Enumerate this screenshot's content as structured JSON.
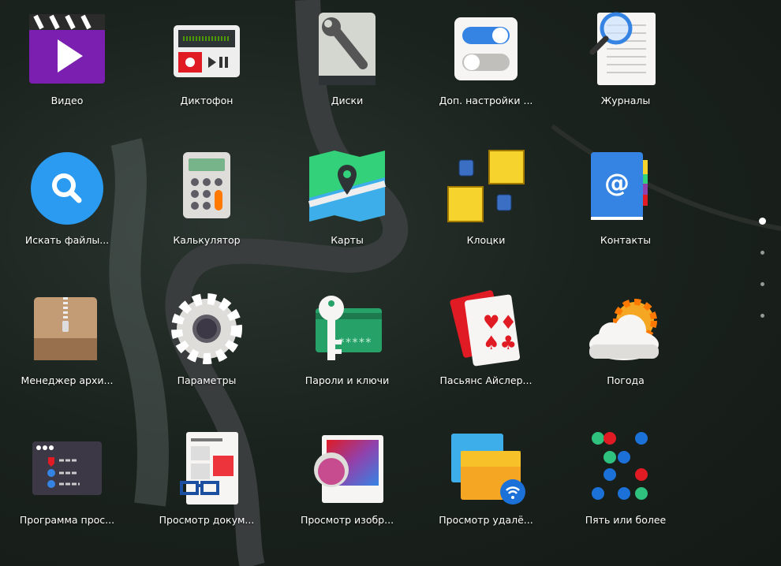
{
  "apps": [
    {
      "label": "Видео",
      "icon": "video-icon"
    },
    {
      "label": "Диктофон",
      "icon": "sound-recorder-icon"
    },
    {
      "label": "Диски",
      "icon": "disks-icon"
    },
    {
      "label": "Доп. настройки ...",
      "icon": "tweaks-icon"
    },
    {
      "label": "Журналы",
      "icon": "logs-icon"
    },
    {
      "label": "Искать файлы...",
      "icon": "search-files-icon"
    },
    {
      "label": "Калькулятор",
      "icon": "calculator-icon"
    },
    {
      "label": "Карты",
      "icon": "maps-icon"
    },
    {
      "label": "Клоцки",
      "icon": "klotski-icon"
    },
    {
      "label": "Контакты",
      "icon": "contacts-icon"
    },
    {
      "label": "Менеджер архи...",
      "icon": "archive-manager-icon"
    },
    {
      "label": "Параметры",
      "icon": "settings-icon"
    },
    {
      "label": "Пароли и ключи",
      "icon": "passwords-keys-icon"
    },
    {
      "label": "Пасьянс Айслер...",
      "icon": "solitaire-icon"
    },
    {
      "label": "Погода",
      "icon": "weather-icon"
    },
    {
      "label": "Программа прос...",
      "icon": "system-monitor-icon"
    },
    {
      "label": "Просмотр докум...",
      "icon": "document-viewer-icon"
    },
    {
      "label": "Просмотр изобр...",
      "icon": "image-viewer-icon"
    },
    {
      "label": "Просмотр удалё...",
      "icon": "remote-viewer-icon"
    },
    {
      "label": "Пять или более",
      "icon": "five-or-more-icon"
    }
  ],
  "pager": {
    "pages": 4,
    "current": 1
  }
}
